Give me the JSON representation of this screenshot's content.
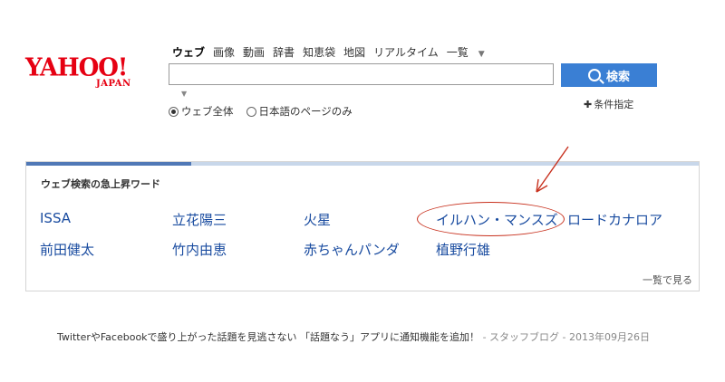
{
  "logo": {
    "main": "YAHOO!",
    "sub": "JAPAN"
  },
  "nav": {
    "items": [
      "ウェブ",
      "画像",
      "動画",
      "辞書",
      "知恵袋",
      "地図",
      "リアルタイム",
      "一覧"
    ]
  },
  "search": {
    "value": "",
    "button_label": "検索",
    "conditions_label": "条件指定"
  },
  "radios": [
    {
      "label": "ウェブ全体",
      "checked": true
    },
    {
      "label": "日本語のページのみ",
      "checked": false
    }
  ],
  "trending": {
    "title": "ウェブ検索の急上昇ワード",
    "words": [
      "ISSA",
      "立花陽三",
      "火星",
      "イルハン・マンスズ",
      "ロードカナロア",
      "前田健太",
      "竹内由恵",
      "赤ちゃんパンダ",
      "植野行雄"
    ],
    "see_all": "一覧で見る"
  },
  "footer": {
    "headline": "TwitterやFacebookで盛り上がった話題を見逃さない 「話題なう」アプリに通知機能を追加！",
    "separator": "-",
    "source": "スタッフブログ",
    "date": "2013年09月26日"
  },
  "colors": {
    "brand": "#e60012",
    "button": "#3a7fd4",
    "link": "#1a4ca0",
    "annotation": "#c8311e"
  }
}
